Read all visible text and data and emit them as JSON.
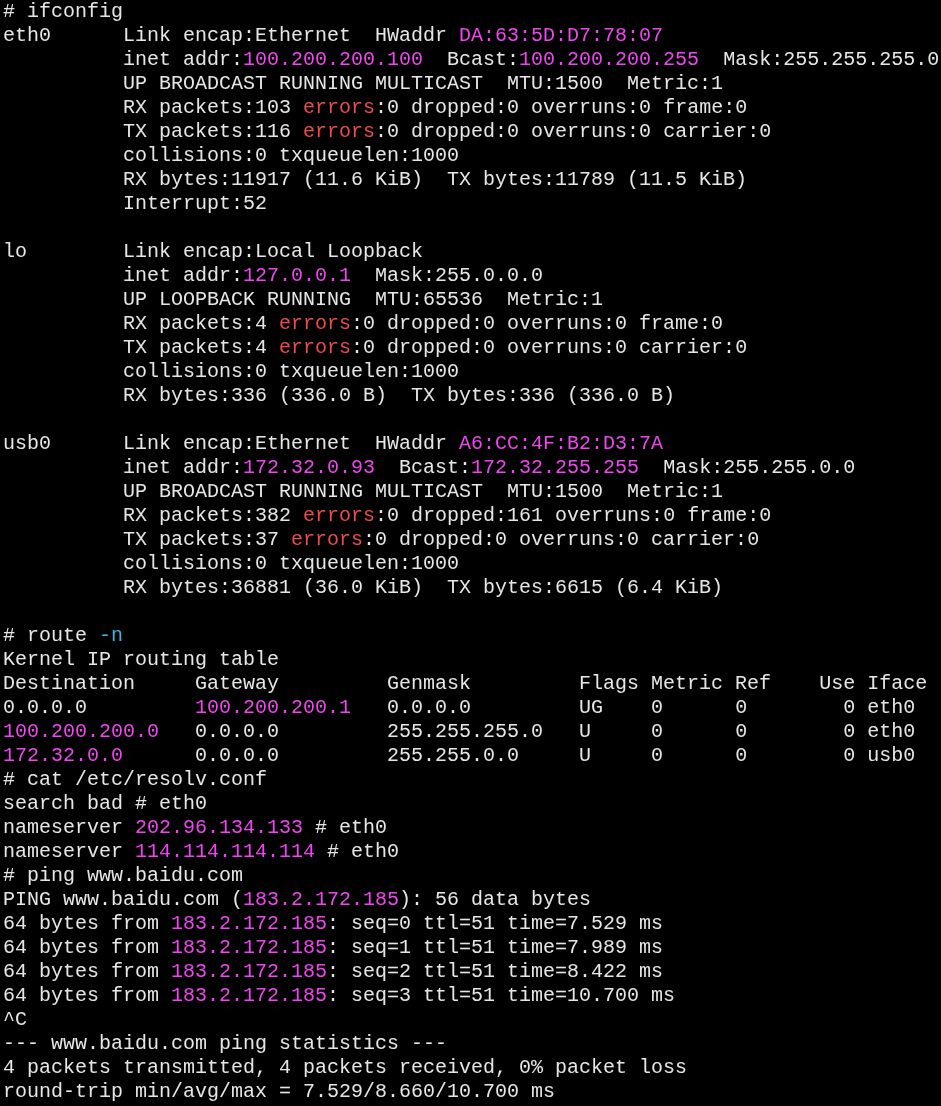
{
  "terminal": {
    "lines": [
      {
        "kind": "text",
        "segments": [
          {
            "kind": "plain",
            "text": "# ifconfig"
          }
        ]
      },
      {
        "kind": "text",
        "segments": [
          {
            "kind": "plain",
            "text": "eth0      Link encap:Ethernet  HWaddr "
          },
          {
            "kind": "address",
            "text": "DA:63:5D:D7:78:07"
          }
        ]
      },
      {
        "kind": "text",
        "segments": [
          {
            "kind": "plain",
            "text": "          inet addr:"
          },
          {
            "kind": "address",
            "text": "100.200.200.100"
          },
          {
            "kind": "plain",
            "text": "  Bcast:"
          },
          {
            "kind": "address",
            "text": "100.200.200.255"
          },
          {
            "kind": "plain",
            "text": "  Mask:255.255.255.0"
          }
        ]
      },
      {
        "kind": "text",
        "segments": [
          {
            "kind": "plain",
            "text": "          UP BROADCAST RUNNING MULTICAST  MTU:1500  Metric:1"
          }
        ]
      },
      {
        "kind": "text",
        "segments": [
          {
            "kind": "plain",
            "text": "          RX packets:103 "
          },
          {
            "kind": "error",
            "text": "errors"
          },
          {
            "kind": "plain",
            "text": ":0 dropped:0 overruns:0 frame:0"
          }
        ]
      },
      {
        "kind": "text",
        "segments": [
          {
            "kind": "plain",
            "text": "          TX packets:116 "
          },
          {
            "kind": "error",
            "text": "errors"
          },
          {
            "kind": "plain",
            "text": ":0 dropped:0 overruns:0 carrier:0"
          }
        ]
      },
      {
        "kind": "text",
        "segments": [
          {
            "kind": "plain",
            "text": "          collisions:0 txqueuelen:1000"
          }
        ]
      },
      {
        "kind": "text",
        "segments": [
          {
            "kind": "plain",
            "text": "          RX bytes:11917 (11.6 KiB)  TX bytes:11789 (11.5 KiB)"
          }
        ]
      },
      {
        "kind": "text",
        "segments": [
          {
            "kind": "plain",
            "text": "          Interrupt:52"
          }
        ]
      },
      {
        "kind": "blank"
      },
      {
        "kind": "text",
        "segments": [
          {
            "kind": "plain",
            "text": "lo        Link encap:Local Loopback"
          }
        ]
      },
      {
        "kind": "text",
        "segments": [
          {
            "kind": "plain",
            "text": "          inet addr:"
          },
          {
            "kind": "address",
            "text": "127.0.0.1"
          },
          {
            "kind": "plain",
            "text": "  Mask:255.0.0.0"
          }
        ]
      },
      {
        "kind": "text",
        "segments": [
          {
            "kind": "plain",
            "text": "          UP LOOPBACK RUNNING  MTU:65536  Metric:1"
          }
        ]
      },
      {
        "kind": "text",
        "segments": [
          {
            "kind": "plain",
            "text": "          RX packets:4 "
          },
          {
            "kind": "error",
            "text": "errors"
          },
          {
            "kind": "plain",
            "text": ":0 dropped:0 overruns:0 frame:0"
          }
        ]
      },
      {
        "kind": "text",
        "segments": [
          {
            "kind": "plain",
            "text": "          TX packets:4 "
          },
          {
            "kind": "error",
            "text": "errors"
          },
          {
            "kind": "plain",
            "text": ":0 dropped:0 overruns:0 carrier:0"
          }
        ]
      },
      {
        "kind": "text",
        "segments": [
          {
            "kind": "plain",
            "text": "          collisions:0 txqueuelen:1000"
          }
        ]
      },
      {
        "kind": "text",
        "segments": [
          {
            "kind": "plain",
            "text": "          RX bytes:336 (336.0 B)  TX bytes:336 (336.0 B)"
          }
        ]
      },
      {
        "kind": "blank"
      },
      {
        "kind": "text",
        "segments": [
          {
            "kind": "plain",
            "text": "usb0      Link encap:Ethernet  HWaddr "
          },
          {
            "kind": "address",
            "text": "A6:CC:4F:B2:D3:7A"
          }
        ]
      },
      {
        "kind": "text",
        "segments": [
          {
            "kind": "plain",
            "text": "          inet addr:"
          },
          {
            "kind": "address",
            "text": "172.32.0.93"
          },
          {
            "kind": "plain",
            "text": "  Bcast:"
          },
          {
            "kind": "address",
            "text": "172.32.255.255"
          },
          {
            "kind": "plain",
            "text": "  Mask:255.255.0.0"
          }
        ]
      },
      {
        "kind": "text",
        "segments": [
          {
            "kind": "plain",
            "text": "          UP BROADCAST RUNNING MULTICAST  MTU:1500  Metric:1"
          }
        ]
      },
      {
        "kind": "text",
        "segments": [
          {
            "kind": "plain",
            "text": "          RX packets:382 "
          },
          {
            "kind": "error",
            "text": "errors"
          },
          {
            "kind": "plain",
            "text": ":0 dropped:161 overruns:0 frame:0"
          }
        ]
      },
      {
        "kind": "text",
        "segments": [
          {
            "kind": "plain",
            "text": "          TX packets:37 "
          },
          {
            "kind": "error",
            "text": "errors"
          },
          {
            "kind": "plain",
            "text": ":0 dropped:0 overruns:0 carrier:0"
          }
        ]
      },
      {
        "kind": "text",
        "segments": [
          {
            "kind": "plain",
            "text": "          collisions:0 txqueuelen:1000"
          }
        ]
      },
      {
        "kind": "text",
        "segments": [
          {
            "kind": "plain",
            "text": "          RX bytes:36881 (36.0 KiB)  TX bytes:6615 (6.4 KiB)"
          }
        ]
      },
      {
        "kind": "blank"
      },
      {
        "kind": "text",
        "segments": [
          {
            "kind": "plain",
            "text": "# route "
          },
          {
            "kind": "option",
            "text": "-n"
          }
        ]
      },
      {
        "kind": "text",
        "segments": [
          {
            "kind": "plain",
            "text": "Kernel IP routing table"
          }
        ]
      },
      {
        "kind": "text",
        "segments": [
          {
            "kind": "plain",
            "text": "Destination     Gateway         Genmask         Flags Metric Ref    Use Iface"
          }
        ]
      },
      {
        "kind": "text",
        "segments": [
          {
            "kind": "plain",
            "text": "0.0.0.0         "
          },
          {
            "kind": "address",
            "text": "100.200.200.1"
          },
          {
            "kind": "plain",
            "text": "   0.0.0.0         UG    0      0        0 eth0"
          }
        ]
      },
      {
        "kind": "text",
        "segments": [
          {
            "kind": "address",
            "text": "100.200.200.0"
          },
          {
            "kind": "plain",
            "text": "   0.0.0.0         255.255.255.0   U     0      0        0 eth0"
          }
        ]
      },
      {
        "kind": "text",
        "segments": [
          {
            "kind": "address",
            "text": "172.32.0.0"
          },
          {
            "kind": "plain",
            "text": "      0.0.0.0         255.255.0.0     U     0      0        0 usb0"
          }
        ]
      },
      {
        "kind": "text",
        "segments": [
          {
            "kind": "plain",
            "text": "# cat /etc/resolv.conf"
          }
        ]
      },
      {
        "kind": "text",
        "segments": [
          {
            "kind": "plain",
            "text": "search bad # eth0"
          }
        ]
      },
      {
        "kind": "text",
        "segments": [
          {
            "kind": "plain",
            "text": "nameserver "
          },
          {
            "kind": "address",
            "text": "202.96.134.133"
          },
          {
            "kind": "plain",
            "text": " # eth0"
          }
        ]
      },
      {
        "kind": "text",
        "segments": [
          {
            "kind": "plain",
            "text": "nameserver "
          },
          {
            "kind": "address",
            "text": "114.114.114.114"
          },
          {
            "kind": "plain",
            "text": " # eth0"
          }
        ]
      },
      {
        "kind": "text",
        "segments": [
          {
            "kind": "plain",
            "text": "# ping www.baidu.com"
          }
        ]
      },
      {
        "kind": "text",
        "segments": [
          {
            "kind": "plain",
            "text": "PING www.baidu.com ("
          },
          {
            "kind": "address",
            "text": "183.2.172.185"
          },
          {
            "kind": "plain",
            "text": "): 56 data bytes"
          }
        ]
      },
      {
        "kind": "text",
        "segments": [
          {
            "kind": "plain",
            "text": "64 bytes from "
          },
          {
            "kind": "address",
            "text": "183.2.172.185"
          },
          {
            "kind": "plain",
            "text": ": seq=0 ttl=51 time=7.529 ms"
          }
        ]
      },
      {
        "kind": "text",
        "segments": [
          {
            "kind": "plain",
            "text": "64 bytes from "
          },
          {
            "kind": "address",
            "text": "183.2.172.185"
          },
          {
            "kind": "plain",
            "text": ": seq=1 ttl=51 time=7.989 ms"
          }
        ]
      },
      {
        "kind": "text",
        "segments": [
          {
            "kind": "plain",
            "text": "64 bytes from "
          },
          {
            "kind": "address",
            "text": "183.2.172.185"
          },
          {
            "kind": "plain",
            "text": ": seq=2 ttl=51 time=8.422 ms"
          }
        ]
      },
      {
        "kind": "text",
        "segments": [
          {
            "kind": "plain",
            "text": "64 bytes from "
          },
          {
            "kind": "address",
            "text": "183.2.172.185"
          },
          {
            "kind": "plain",
            "text": ": seq=3 ttl=51 time=10.700 ms"
          }
        ]
      },
      {
        "kind": "text",
        "segments": [
          {
            "kind": "plain",
            "text": "^C"
          }
        ]
      },
      {
        "kind": "text",
        "segments": [
          {
            "kind": "plain",
            "text": "--- www.baidu.com ping statistics ---"
          }
        ]
      },
      {
        "kind": "text",
        "segments": [
          {
            "kind": "plain",
            "text": "4 packets transmitted, 4 packets received, 0% packet loss"
          }
        ]
      },
      {
        "kind": "text",
        "segments": [
          {
            "kind": "plain",
            "text": "round-trip min/avg/max = 7.529/8.660/10.700 ms"
          }
        ]
      }
    ]
  }
}
